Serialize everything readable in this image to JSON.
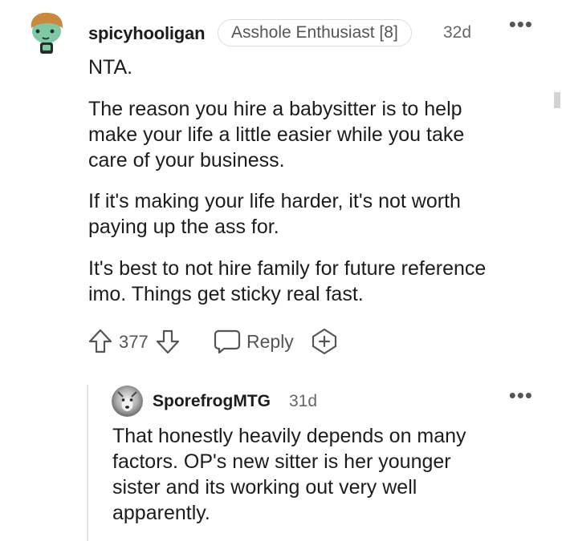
{
  "comment": {
    "author": "spicyhooligan",
    "flair": "Asshole Enthusiast [8]",
    "age": "32d",
    "more_icon": "more-options-icon",
    "paragraphs": [
      "NTA.",
      "The reason you hire a babysitter is to help\nmake your life a little easier while you take\ncare of your business.",
      "If it's making your life harder, it's not worth\npaying up the ass for.",
      "It's best to not hire family for future reference\nimo. Things get sticky real fast."
    ],
    "votes": "377",
    "reply_label": "Reply",
    "icons": {
      "upvote": "upvote-arrow-icon",
      "downvote": "downvote-arrow-icon",
      "reply": "speech-bubble-icon",
      "award": "add-award-icon"
    }
  },
  "reply": {
    "author": "SporefrogMTG",
    "age": "31d",
    "body": "That honestly heavily depends on many\nfactors. OP's new sitter is her younger\nsister and its working out very well\napparently."
  },
  "colors": {
    "text": "#1c1c1c",
    "meta": "#666666",
    "flair_border": "#dcdcdc",
    "thread_line": "#e4e4e4"
  }
}
